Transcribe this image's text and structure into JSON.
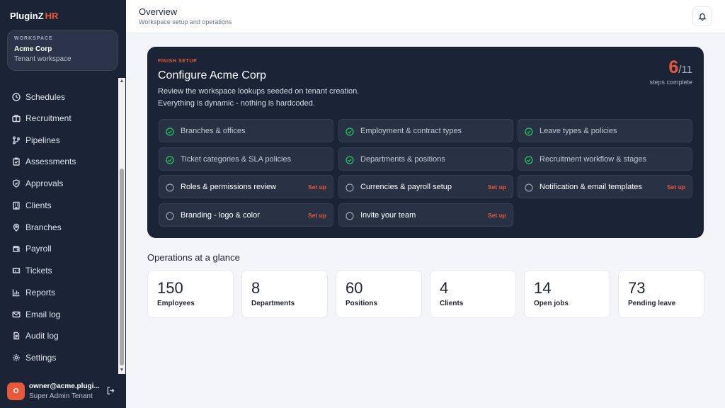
{
  "brand": {
    "name": "PluginZ",
    "suffix": "HR"
  },
  "workspace": {
    "label": "WORKSPACE",
    "name": "Acme Corp",
    "subtitle": "Tenant workspace"
  },
  "nav": [
    {
      "label": "Schedules",
      "icon": "clock-icon"
    },
    {
      "label": "Recruitment",
      "icon": "briefcase-icon"
    },
    {
      "label": "Pipelines",
      "icon": "pipeline-icon"
    },
    {
      "label": "Assessments",
      "icon": "clipboard-icon"
    },
    {
      "label": "Approvals",
      "icon": "shield-check-icon"
    },
    {
      "label": "Clients",
      "icon": "building-icon"
    },
    {
      "label": "Branches",
      "icon": "map-pin-icon"
    },
    {
      "label": "Payroll",
      "icon": "wallet-icon"
    },
    {
      "label": "Tickets",
      "icon": "ticket-icon"
    },
    {
      "label": "Reports",
      "icon": "bar-chart-icon"
    },
    {
      "label": "Email log",
      "icon": "mail-icon"
    },
    {
      "label": "Audit log",
      "icon": "file-log-icon"
    },
    {
      "label": "Settings",
      "icon": "gear-icon"
    }
  ],
  "user": {
    "initial": "O",
    "email": "owner@acme.plugi...",
    "role": "Super Admin Tenant"
  },
  "header": {
    "title": "Overview",
    "subtitle": "Workspace setup and operations"
  },
  "setup": {
    "label": "FINISH SETUP",
    "title": "Configure Acme Corp",
    "desc1": "Review the workspace lookups seeded on tenant creation.",
    "desc2": "Everything is dynamic - nothing is hardcoded.",
    "done": "6",
    "total": "/11",
    "caption": "steps complete",
    "action_label": "Set up",
    "steps": [
      {
        "name": "Branches & offices",
        "complete": true
      },
      {
        "name": "Employment & contract types",
        "complete": true
      },
      {
        "name": "Leave types & policies",
        "complete": true
      },
      {
        "name": "Ticket categories & SLA policies",
        "complete": true
      },
      {
        "name": "Departments & positions",
        "complete": true
      },
      {
        "name": "Recruitment workflow & stages",
        "complete": true
      },
      {
        "name": "Roles & permissions review",
        "complete": false
      },
      {
        "name": "Currencies & payroll setup",
        "complete": false
      },
      {
        "name": "Notification & email templates",
        "complete": false
      },
      {
        "name": "Branding - logo & color",
        "complete": false
      },
      {
        "name": "Invite your team",
        "complete": false
      }
    ]
  },
  "operations": {
    "title": "Operations at a glance",
    "stats": [
      {
        "value": "150",
        "label": "Employees"
      },
      {
        "value": "8",
        "label": "Departments"
      },
      {
        "value": "60",
        "label": "Positions"
      },
      {
        "value": "4",
        "label": "Clients"
      },
      {
        "value": "14",
        "label": "Open jobs"
      },
      {
        "value": "73",
        "label": "Pending leave"
      }
    ]
  },
  "colors": {
    "accent": "#e8583a",
    "sidebar": "#1b2436",
    "success": "#22c55e"
  }
}
